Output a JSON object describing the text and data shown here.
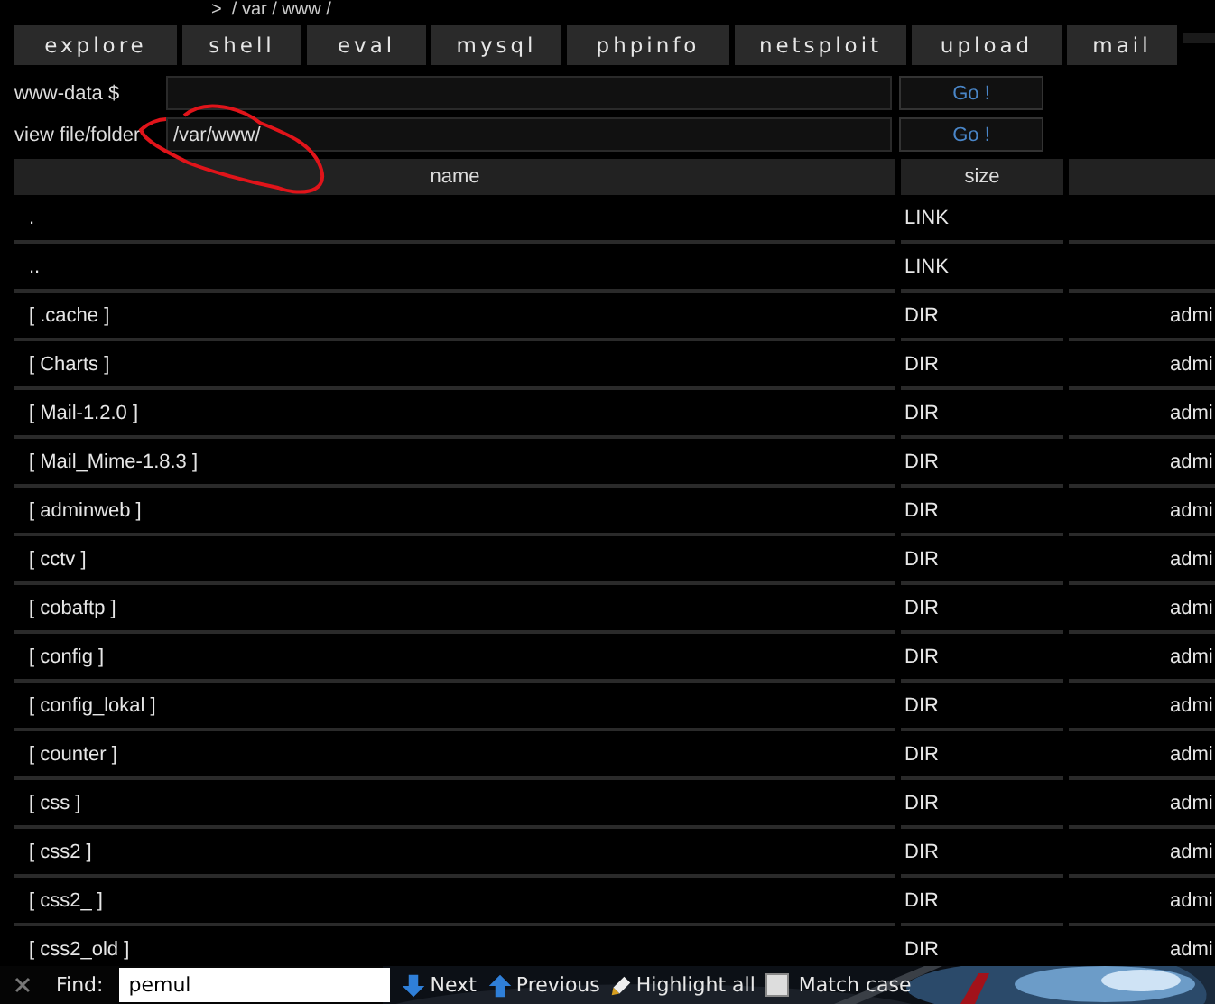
{
  "path": ">  / var / www /",
  "tabs": [
    "explore",
    "shell",
    "eval",
    "mysql",
    "phpinfo",
    "netsploit",
    "upload",
    "mail"
  ],
  "forms": [
    {
      "label": "www-data $",
      "button": "Go !"
    },
    {
      "label": "view file/folder",
      "value": "/var/www/",
      "button": "Go !"
    }
  ],
  "table": {
    "columns": [
      "name",
      "size"
    ],
    "rows": [
      {
        "name": ".",
        "size": "LINK",
        "column_3": ""
      },
      {
        "name": "..",
        "size": "LINK",
        "column_3": ""
      },
      {
        "name": "[ .cache ]",
        "size": "DIR",
        "column_3": "admi"
      },
      {
        "name": "[ Charts ]",
        "size": "DIR",
        "column_3": "admi"
      },
      {
        "name": "[ Mail-1.2.0 ]",
        "size": "DIR",
        "column_3": "admi"
      },
      {
        "name": "[ Mail_Mime-1.8.3 ]",
        "size": "DIR",
        "column_3": "admi"
      },
      {
        "name": "[ adminweb ]",
        "size": "DIR",
        "column_3": "admi"
      },
      {
        "name": "[ cctv ]",
        "size": "DIR",
        "column_3": "admi"
      },
      {
        "name": "[ cobaftp ]",
        "size": "DIR",
        "column_3": "admi"
      },
      {
        "name": "[ config ]",
        "size": "DIR",
        "column_3": "admi"
      },
      {
        "name": "[ config_lokal ]",
        "size": "DIR",
        "column_3": "admi"
      },
      {
        "name": "[ counter ]",
        "size": "DIR",
        "column_3": "admi"
      },
      {
        "name": "[ css ]",
        "size": "DIR",
        "column_3": "admi"
      },
      {
        "name": "[ css2 ]",
        "size": "DIR",
        "column_3": "admi"
      },
      {
        "name": "[ css2_ ]",
        "size": "DIR",
        "column_3": "admi"
      },
      {
        "name": "[ css2_old ]",
        "size": "DIR",
        "column_3": "admi"
      }
    ]
  },
  "find_bar": {
    "label": "Find:",
    "value": "pemul",
    "next": "Next",
    "previous": "Previous",
    "highlight": "Highlight all",
    "match_case": {
      "label": "Match case",
      "checked": false
    }
  }
}
